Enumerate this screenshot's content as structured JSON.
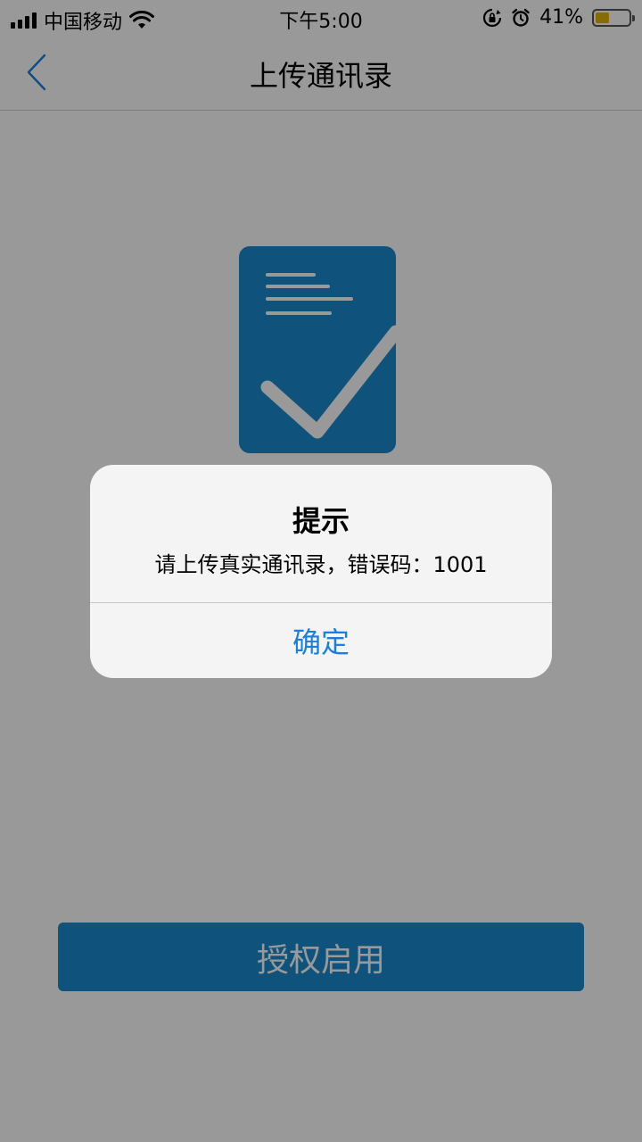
{
  "status_bar": {
    "carrier": "中国移动",
    "time": "下午5:00",
    "battery_percent": "41%",
    "battery_level": 0.41,
    "icons": [
      "signal-icon",
      "wifi-icon",
      "rotation-lock-icon",
      "alarm-icon",
      "battery-icon"
    ]
  },
  "nav": {
    "title": "上传通讯录",
    "back_icon": "chevron-left-icon"
  },
  "main": {
    "illustration_icon": "document-check-icon",
    "button_label": "授权启用"
  },
  "alert": {
    "title": "提示",
    "message": "请上传真实通讯录，错误码：1001",
    "confirm_label": "确定"
  },
  "colors": {
    "primary": "#1a8ad0",
    "alert_button_text": "#1b7fe0",
    "overlay": "rgba(0,0,0,0.40)",
    "battery_fill": "#e5b400"
  }
}
